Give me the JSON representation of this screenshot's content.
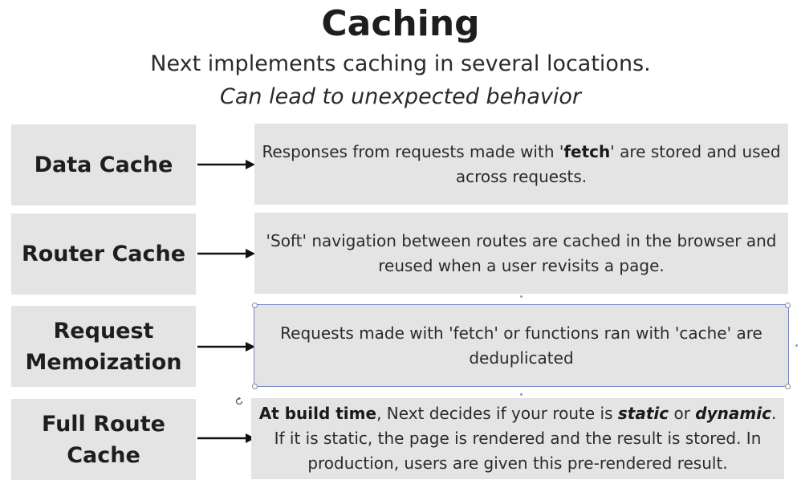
{
  "title": "Caching",
  "subtitle": "Next implements caching in several locations.",
  "note": "Can lead to unexpected behavior",
  "rows": [
    {
      "label_lines": [
        "Data Cache"
      ],
      "desc_html": "Responses from requests made with '<b>fetch</b>' are stored and used across requests."
    },
    {
      "label_lines": [
        "Router Cache"
      ],
      "desc_html": "'Soft' navigation between routes are cached in the browser and reused when a user revisits a page."
    },
    {
      "label_lines": [
        "Request",
        "Memoization"
      ],
      "desc_html": "Requests made with 'fetch' or functions ran with 'cache' are deduplicated"
    },
    {
      "label_lines": [
        "Full Route",
        "Cache"
      ],
      "desc_html": "<b>At build time</b>, Next decides if your route is <b><i>static</i></b> or <b><i>dynamic</i></b>. If it is static, the page is rendered and the result is stored. In production, users are given this pre-rendered result."
    }
  ],
  "colors": {
    "box_fill": "#e4e4e4",
    "selection_outline": "#7b86c9",
    "arrow": "#111111"
  },
  "icons": {
    "arrow": "right-arrow-icon",
    "rotate": "rotate-handle-icon"
  }
}
